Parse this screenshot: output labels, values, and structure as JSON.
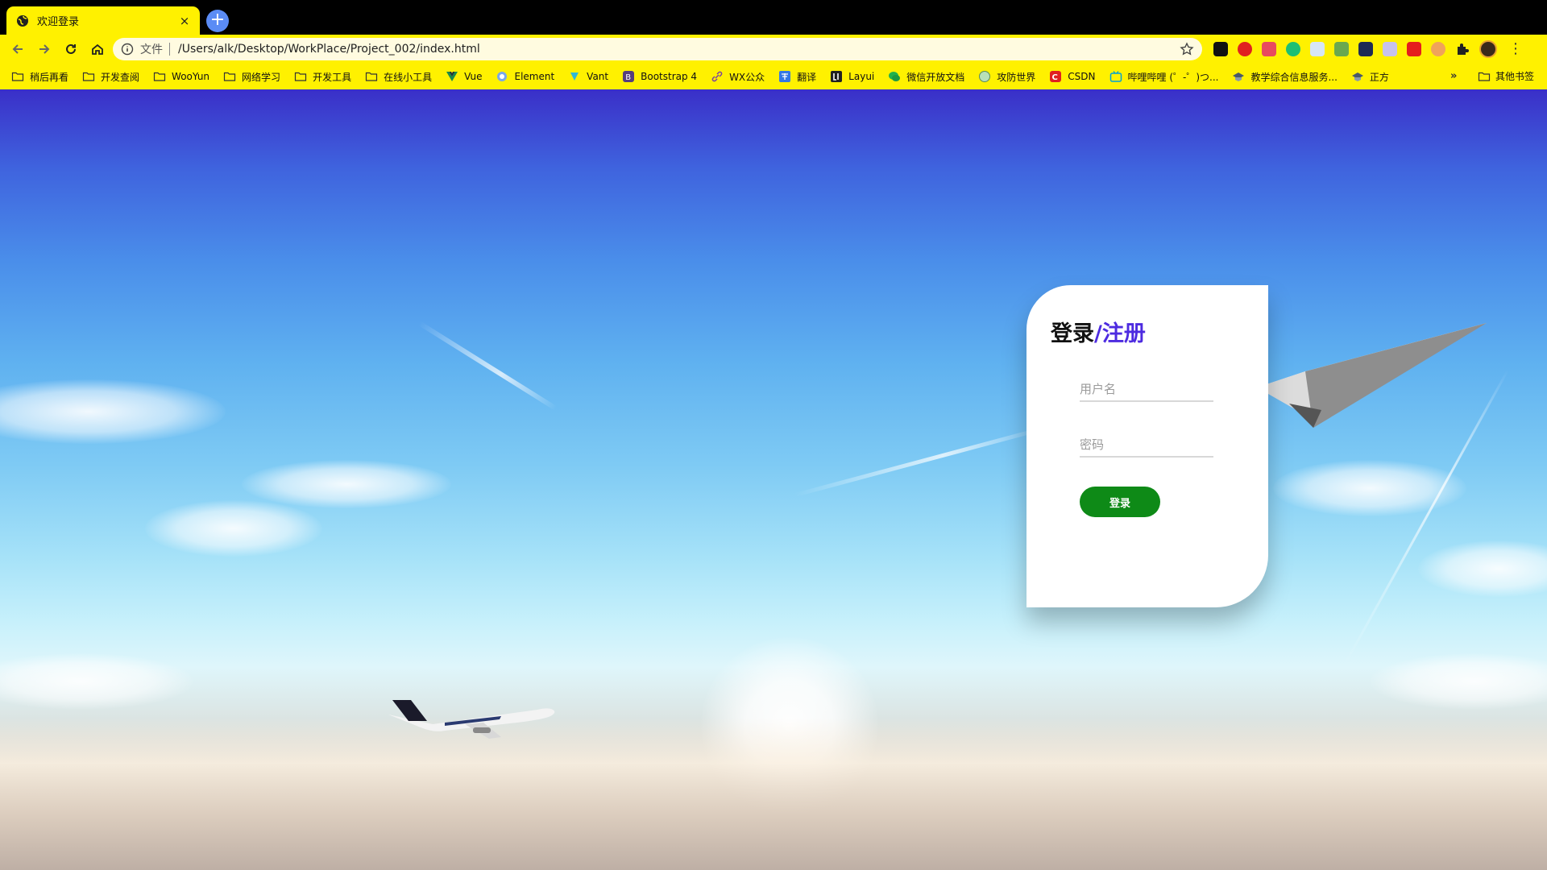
{
  "browser": {
    "tab_title": "欢迎登录",
    "tab_close": "×",
    "new_tab": "+",
    "scheme_label": "文件",
    "url": "/Users/alk/Desktop/WorkPlace/Project_002/index.html",
    "kebab": "⋮"
  },
  "bookmarks": {
    "items": [
      {
        "label": "稍后再看",
        "icon": "folder-icon"
      },
      {
        "label": "开发查阅",
        "icon": "folder-icon"
      },
      {
        "label": "WooYun",
        "icon": "folder-icon"
      },
      {
        "label": "网络学习",
        "icon": "folder-icon"
      },
      {
        "label": "开发工具",
        "icon": "folder-icon"
      },
      {
        "label": "在线小工具",
        "icon": "folder-icon"
      },
      {
        "label": "Vue",
        "icon": "vue-icon"
      },
      {
        "label": "Element",
        "icon": "element-icon"
      },
      {
        "label": "Vant",
        "icon": "vant-icon"
      },
      {
        "label": "Bootstrap 4",
        "icon": "bootstrap-icon"
      },
      {
        "label": "WX公众",
        "icon": "link-icon"
      },
      {
        "label": "翻译",
        "icon": "translate-icon"
      },
      {
        "label": "Layui",
        "icon": "layui-icon"
      },
      {
        "label": "微信开放文档",
        "icon": "wechat-icon"
      },
      {
        "label": "攻防世界",
        "icon": "globe-icon"
      },
      {
        "label": "CSDN",
        "icon": "csdn-icon"
      },
      {
        "label": "哔哩哔哩 (゜-゜)つ...",
        "icon": "bilibili-icon"
      },
      {
        "label": "教学综合信息服务...",
        "icon": "school-icon"
      },
      {
        "label": "正方",
        "icon": "school-icon"
      }
    ],
    "more": "»",
    "other_label": "其他书签"
  },
  "login": {
    "title_login": "登录",
    "title_register": "/注册",
    "username_placeholder": "用户名",
    "password_placeholder": "密码",
    "submit_label": "登录",
    "accent_color": "#4d2be0",
    "button_color": "#0e8a17"
  }
}
